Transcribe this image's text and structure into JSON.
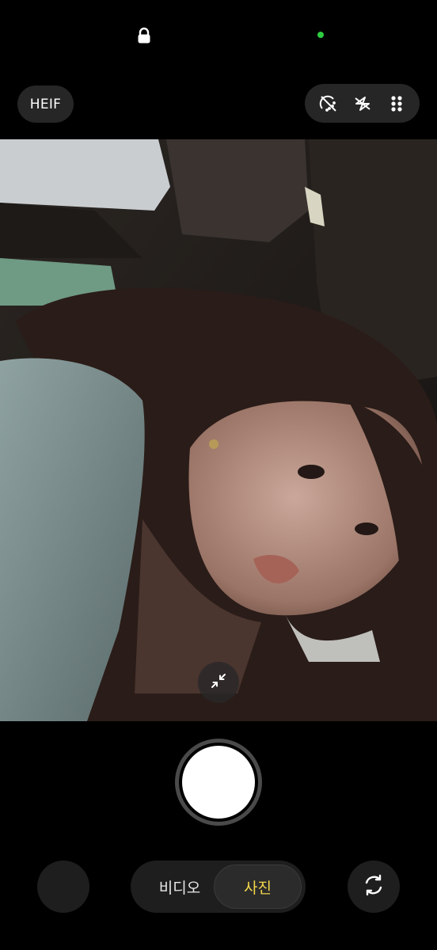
{
  "status": {
    "lock_icon": "lock-icon",
    "camera_indicator_color": "#2ecc40"
  },
  "top": {
    "format_label": "HEIF",
    "tools": [
      {
        "icon": "filter-off-icon"
      },
      {
        "icon": "flash-off-icon"
      },
      {
        "icon": "more-grid-icon"
      }
    ]
  },
  "viewfinder": {
    "content": "selfie-preview",
    "collapse_icon": "collapse-arrows-icon"
  },
  "bottom": {
    "modes": {
      "video_label": "비디오",
      "photo_label": "사진"
    },
    "active_mode_color": "#f2d64a",
    "flip_icon": "flip-camera-icon"
  }
}
